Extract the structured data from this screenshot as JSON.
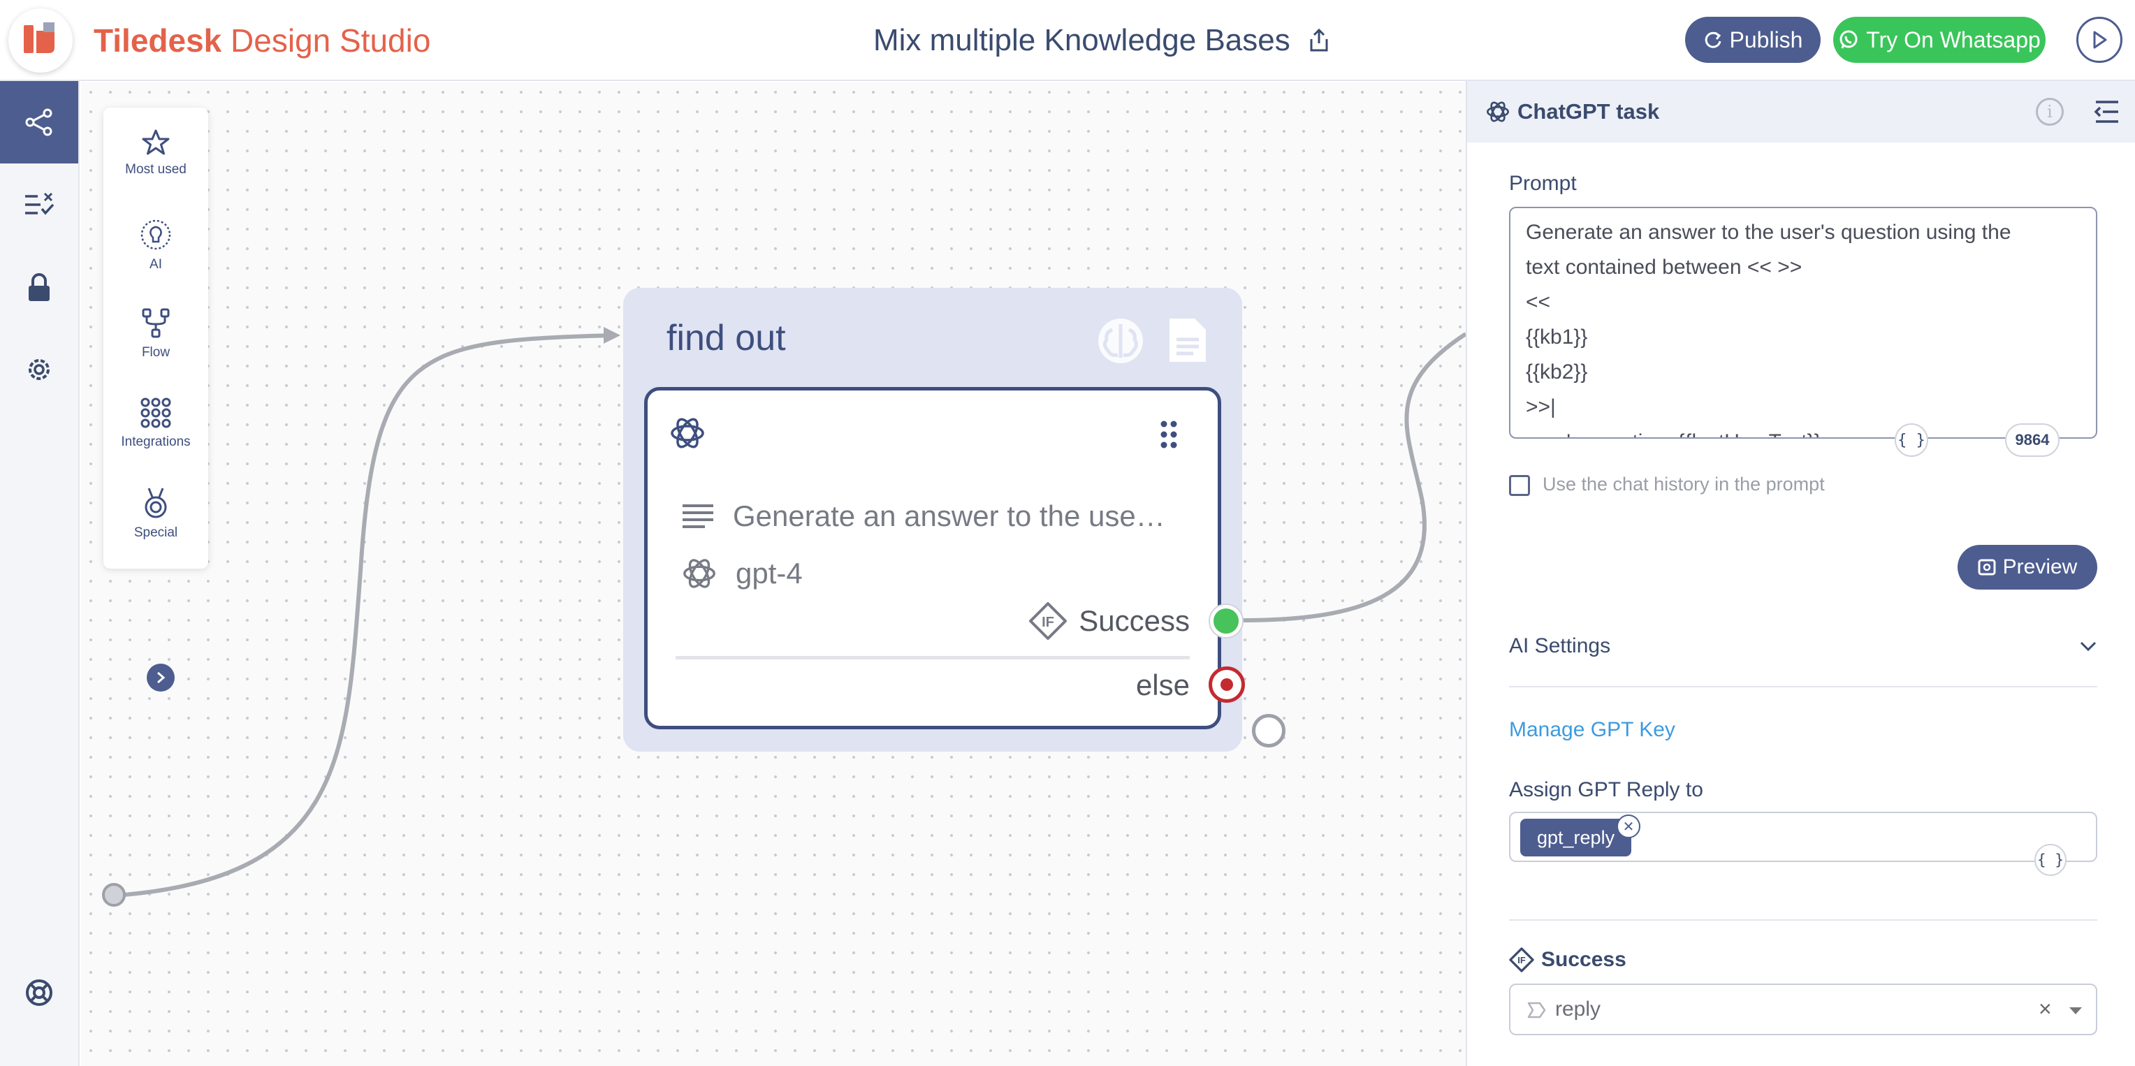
{
  "app": {
    "brand_bold": "Tiledesk",
    "brand_rest": "Design Studio",
    "doc_title": "Mix multiple Knowledge Bases",
    "publish_label": "Publish",
    "whatsapp_label": "Try On Whatsapp"
  },
  "palette": {
    "items": [
      {
        "label": "Most used",
        "icon": "star-icon"
      },
      {
        "label": "AI",
        "icon": "ai-icon"
      },
      {
        "label": "Flow",
        "icon": "flow-icon"
      },
      {
        "label": "Integrations",
        "icon": "integrations-icon"
      },
      {
        "label": "Special",
        "icon": "medal-icon"
      }
    ]
  },
  "block": {
    "title": "find out",
    "action_prompt": "Generate an answer to the use…",
    "action_model": "gpt-4",
    "success_label": "Success",
    "else_label": "else"
  },
  "panel": {
    "title": "ChatGPT task",
    "prompt_label": "Prompt",
    "prompt_lines": [
      "Generate an answer to the user's question using the",
      "text contained between << >>",
      "<<",
      "{{kb1}}",
      "{{kb2}}",
      ">>|",
      "user's question: {{lastUserText}}"
    ],
    "prompt_count": "9864",
    "chat_history_label": "Use the chat history in the prompt",
    "preview_label": "Preview",
    "ai_settings_label": "AI Settings",
    "manage_key_label": "Manage GPT Key",
    "assign_label": "Assign GPT Reply to",
    "assign_tag": "gpt_reply",
    "success_label": "Success",
    "success_value": "reply"
  },
  "colors": {
    "brand": "#e4624a",
    "primary": "#4d5d8f",
    "whatsapp": "#3ac55a",
    "success": "#48c25a",
    "error": "#c42a30",
    "link": "#3c9be0"
  }
}
